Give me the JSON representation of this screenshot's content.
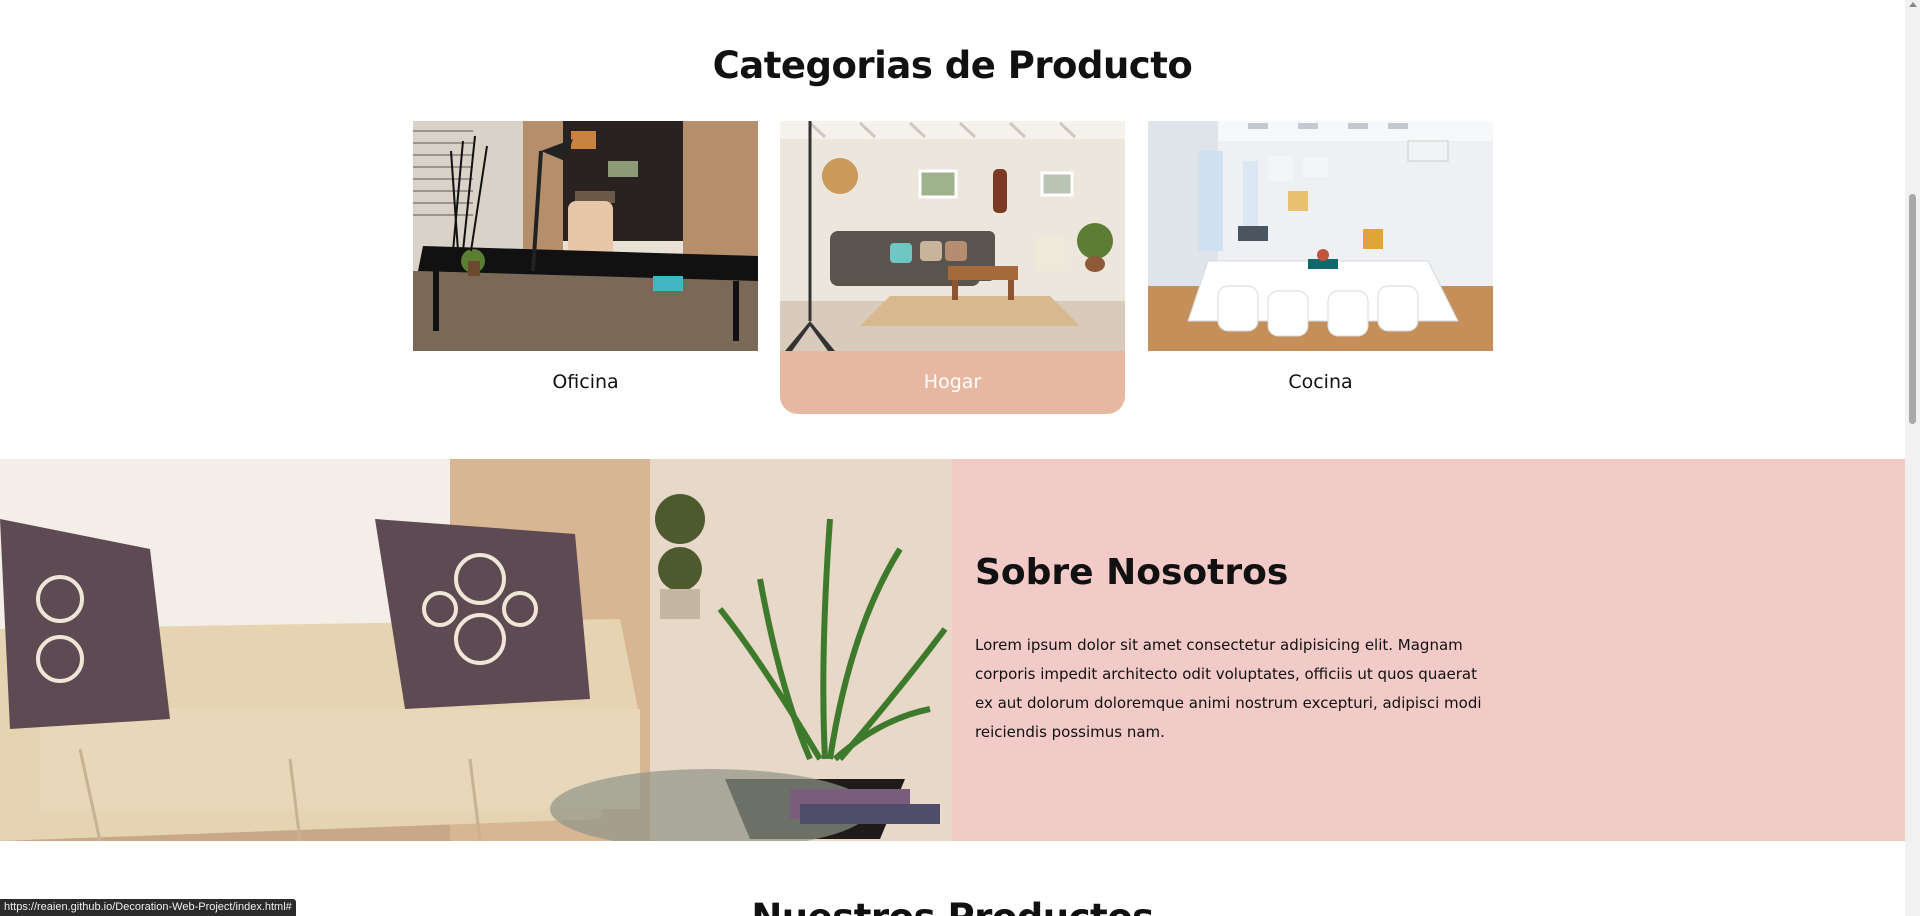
{
  "categories": {
    "title": "Categorias de Producto",
    "items": [
      {
        "label": "Oficina",
        "active": false
      },
      {
        "label": "Hogar",
        "active": true
      },
      {
        "label": "Cocina",
        "active": false
      }
    ]
  },
  "about": {
    "title": "Sobre Nosotros",
    "text": "Lorem ipsum dolor sit amet consectetur adipisicing elit. Magnam corporis impedit architecto odit voluptates, officiis ut quos quaerat ex aut dolorum doloremque animi nostrum excepturi, adipisci modi reiciendis possimus nam."
  },
  "products": {
    "title": "Nuestros Productos"
  },
  "status_bar": {
    "url": "https://reaien.github.io/Decoration-Web-Project/index.html#"
  },
  "colors": {
    "active_card": "#e6b8a2",
    "about_panel": "#f2cbc8"
  }
}
